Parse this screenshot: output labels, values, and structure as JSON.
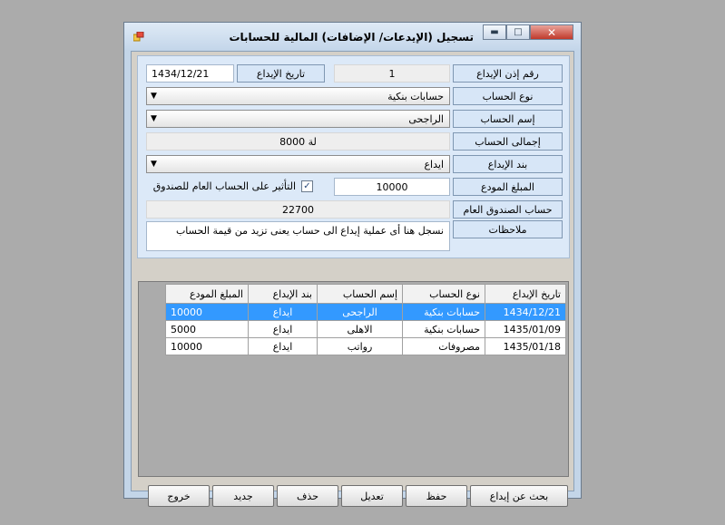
{
  "window": {
    "title": "تسجيل (الإيدعات/ الإضافات) المالية للحسابات",
    "minimize_glyph": "▬",
    "maximize_glyph": "□",
    "close_glyph": "✕"
  },
  "form": {
    "deposit_no_label": "رقم إذن الإيداع",
    "deposit_no_value": "1",
    "deposit_date_label": "تاريخ الإيداع",
    "deposit_date_value": "1434/12/21",
    "account_type_label": "نوع الحساب",
    "account_type_value": "حسابات بنكية",
    "account_name_label": "إسم الحساب",
    "account_name_value": "الراجحى",
    "account_total_label": "إجمالى الحساب",
    "account_total_value": "لة 8000",
    "deposit_item_label": "بند الإيداع",
    "deposit_item_value": "ايداع",
    "deposited_amount_label": "المبلغ المودع",
    "deposited_amount_value": "10000",
    "affect_cashbox_label": "التأثير على الحساب العام للصندوق",
    "affect_cashbox_checked": true,
    "cashbox_account_label": "حساب الصندوق العام",
    "cashbox_account_value": "22700",
    "notes_label": "ملاحظات",
    "notes_value": "نسجل هنا أى عملية إيداع الى حساب يعنى تزيد من قيمة الحساب"
  },
  "grid": {
    "columns": [
      "تاريخ الإيداع",
      "نوع الحساب",
      "إسم الحساب",
      "بند الإيداع",
      "المبلغ المودع"
    ],
    "rows": [
      {
        "date": "1434/12/21",
        "type": "حسابات بنكية",
        "name": "الراجحى",
        "item": "ايداع",
        "amount": "10000",
        "selected": true
      },
      {
        "date": "1435/01/09",
        "type": "حسابات بنكية",
        "name": "الاهلى",
        "item": "ايداع",
        "amount": "5000",
        "selected": false
      },
      {
        "date": "1435/01/18",
        "type": "مصروفات",
        "name": "رواتب",
        "item": "ايداع",
        "amount": "10000",
        "selected": false
      }
    ]
  },
  "buttons": {
    "search": "بحث عن إيداع",
    "save": "حفظ",
    "edit": "تعديل",
    "delete": "حذف",
    "new": "جديد",
    "exit": "خروج"
  },
  "icons": {
    "app": "app-icon",
    "dropdown": "chevron-down-icon",
    "check": "checkmark-icon"
  },
  "colors": {
    "selection": "#3399ff",
    "panel": "#dce9f8",
    "close_button": "#c0392b"
  }
}
